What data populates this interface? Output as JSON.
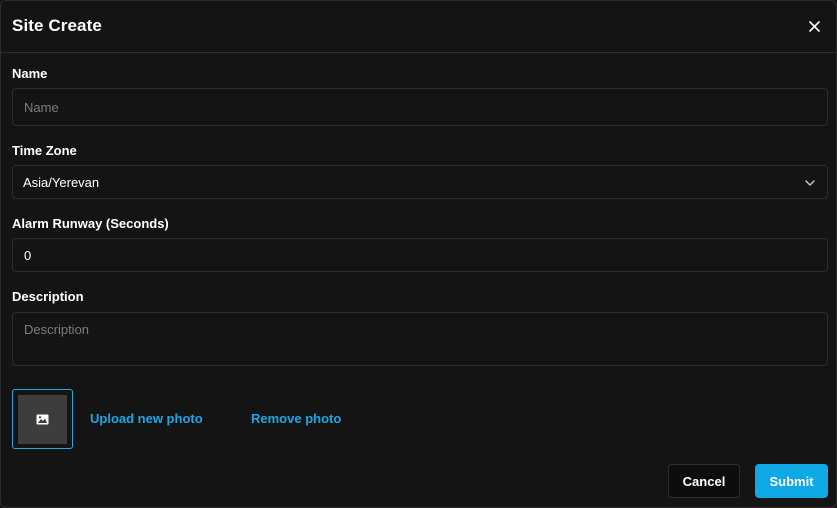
{
  "modal": {
    "title": "Site Create"
  },
  "form": {
    "name": {
      "label": "Name",
      "placeholder": "Name",
      "value": ""
    },
    "time_zone": {
      "label": "Time Zone",
      "value": "Asia/Yerevan"
    },
    "alarm_runway": {
      "label": "Alarm Runway (Seconds)",
      "value": "0"
    },
    "description": {
      "label": "Description",
      "placeholder": "Description",
      "value": ""
    }
  },
  "photo": {
    "upload_label": "Upload new photo",
    "remove_label": "Remove photo",
    "icon": "image-icon"
  },
  "footer": {
    "cancel_label": "Cancel",
    "submit_label": "Submit"
  },
  "colors": {
    "accent": "#0fa8e6",
    "link": "#1ea7e4",
    "background": "#141414",
    "border": "#2e2e2e"
  }
}
